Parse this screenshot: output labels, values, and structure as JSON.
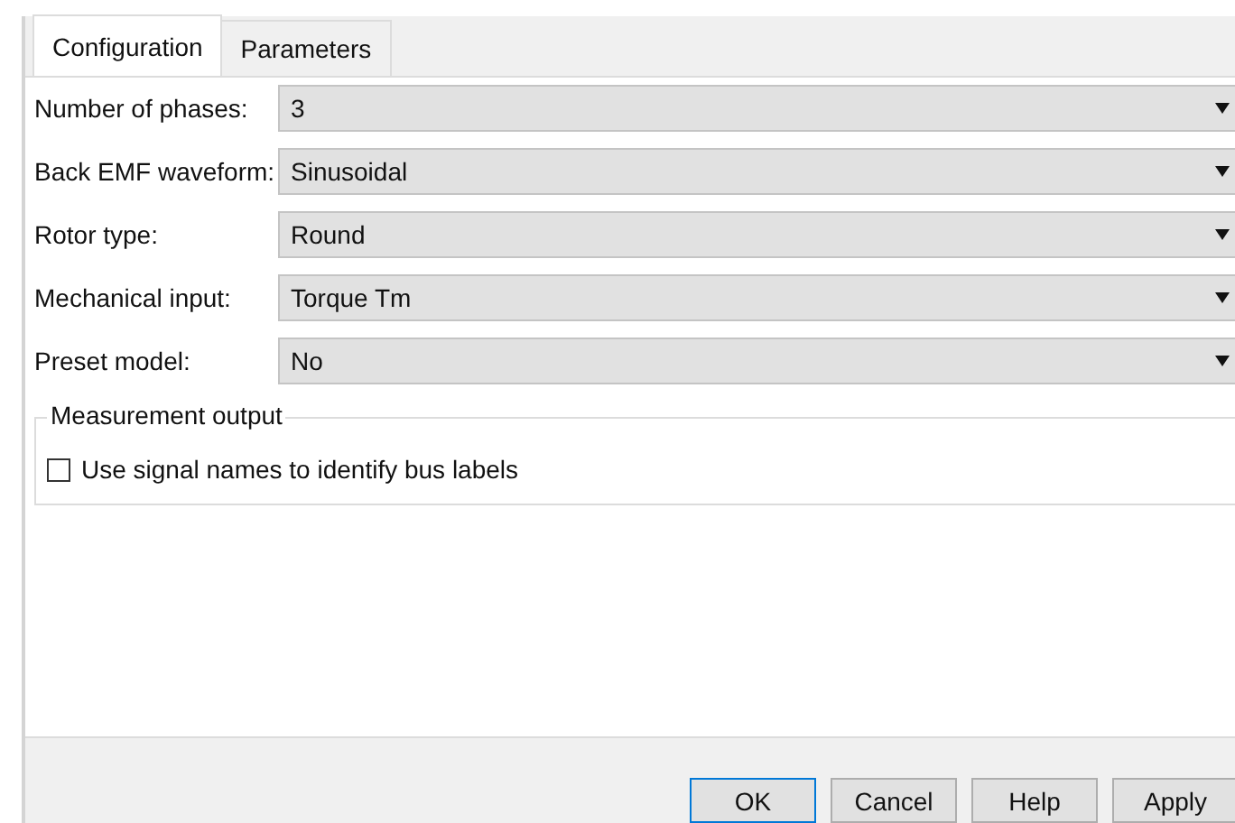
{
  "tabs": [
    {
      "label": "Configuration",
      "selected": true
    },
    {
      "label": "Parameters",
      "selected": false
    }
  ],
  "fields": [
    {
      "label": "Number of phases:",
      "value": "3"
    },
    {
      "label": "Back EMF waveform:",
      "value": "Sinusoidal"
    },
    {
      "label": "Rotor type:",
      "value": "Round"
    },
    {
      "label": "Mechanical input:",
      "value": "Torque Tm"
    },
    {
      "label": "Preset model:",
      "value": "No"
    }
  ],
  "measurement_output": {
    "title": "Measurement output",
    "checkbox": {
      "label": "Use signal names to identify bus labels",
      "checked": false
    }
  },
  "buttons": [
    {
      "label": "OK",
      "selected": true
    },
    {
      "label": "Cancel",
      "selected": false
    },
    {
      "label": "Help",
      "selected": false
    },
    {
      "label": "Apply",
      "selected": false
    }
  ]
}
